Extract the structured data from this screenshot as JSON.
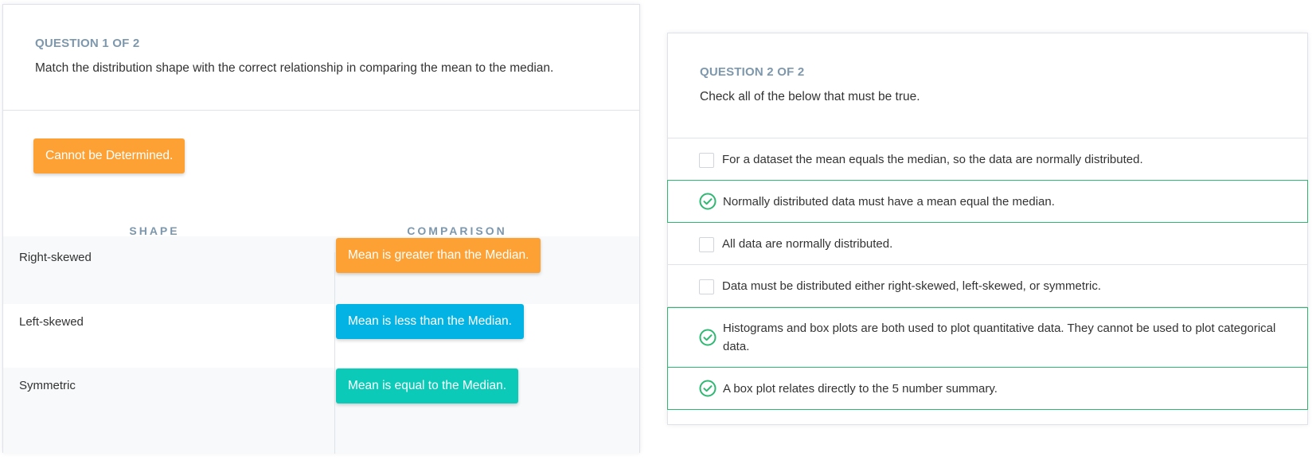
{
  "q1": {
    "number": "QUESTION 1 OF 2",
    "prompt": "Match the distribution shape with the correct relationship in comparing the mean to the median.",
    "unplaced_option": "Cannot be Determined.",
    "col_shape": "SHAPE",
    "col_comparison": "COMPARISON",
    "rows": [
      {
        "shape": "Right-skewed",
        "answer": "Mean is greater than the Median."
      },
      {
        "shape": "Left-skewed",
        "answer": "Mean is less than the Median."
      },
      {
        "shape": "Symmetric",
        "answer": "Mean is equal to the Median."
      }
    ]
  },
  "q2": {
    "number": "QUESTION 2 OF 2",
    "prompt": "Check all of the below that must be true.",
    "options": [
      {
        "text": "For a dataset the mean equals the median, so the data are normally distributed.",
        "checked": false
      },
      {
        "text": "Normally distributed data must have a mean equal the median.",
        "checked": true
      },
      {
        "text": "All data are normally distributed.",
        "checked": false
      },
      {
        "text": "Data must be distributed either right-skewed, left-skewed, or symmetric.",
        "checked": false
      },
      {
        "text": "Histograms and box plots are both used to plot quantitative data. They cannot be used to plot categorical data.",
        "checked": true
      },
      {
        "text": "A box plot relates directly to the 5 number summary.",
        "checked": true
      }
    ]
  },
  "colors": {
    "orange": "#fda135",
    "blue": "#02b3e4",
    "teal": "#0bcbb8",
    "check_green": "#2eb872",
    "label_gray": "#7d97ad"
  }
}
